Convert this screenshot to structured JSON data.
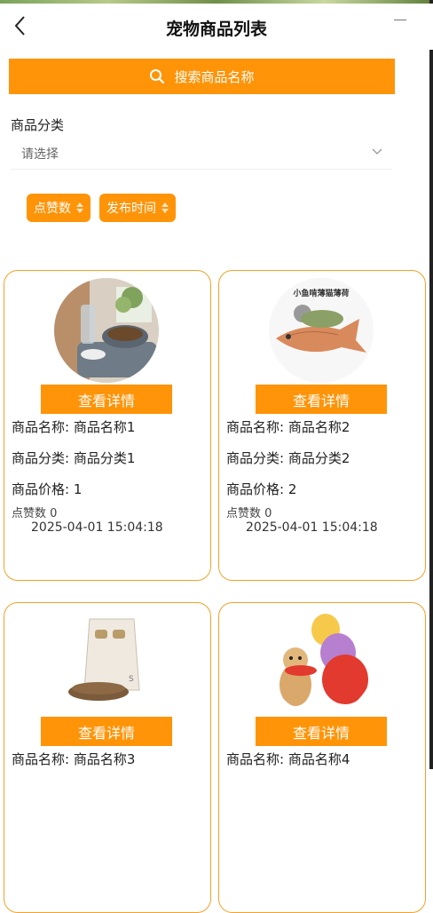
{
  "header": {
    "title": "宠物商品列表"
  },
  "search": {
    "label": "搜索商品名称"
  },
  "filter": {
    "category_label": "商品分类",
    "category_placeholder": "请选择"
  },
  "sort": {
    "likes_label": "点赞数",
    "time_label": "发布时间"
  },
  "colors": {
    "accent": "#ff9408",
    "card_border": "#f3a22a"
  },
  "products": [
    {
      "image": "pet-bowl-feeder",
      "detail_label": "查看详情",
      "name_text": "商品名称: 商品名称1",
      "category_text": "商品分类: 商品分类1",
      "price_text": "商品价格: 1",
      "likes_text": "点赞数 0",
      "time_text": "2025-04-01 15:04:18"
    },
    {
      "image": "fish-catnip-toy",
      "image_caption": "小鱼啃薄猫薄荷",
      "detail_label": "查看详情",
      "name_text": "商品名称: 商品名称2",
      "category_text": "商品分类: 商品分类2",
      "price_text": "商品价格: 2",
      "likes_text": "点赞数 0",
      "time_text": "2025-04-01 15:04:18"
    },
    {
      "image": "pet-food-bag",
      "detail_label": "查看详情",
      "name_text": "商品名称: 商品名称3"
    },
    {
      "image": "dog-frisbee-balloons",
      "detail_label": "查看详情",
      "name_text": "商品名称: 商品名称4"
    }
  ]
}
